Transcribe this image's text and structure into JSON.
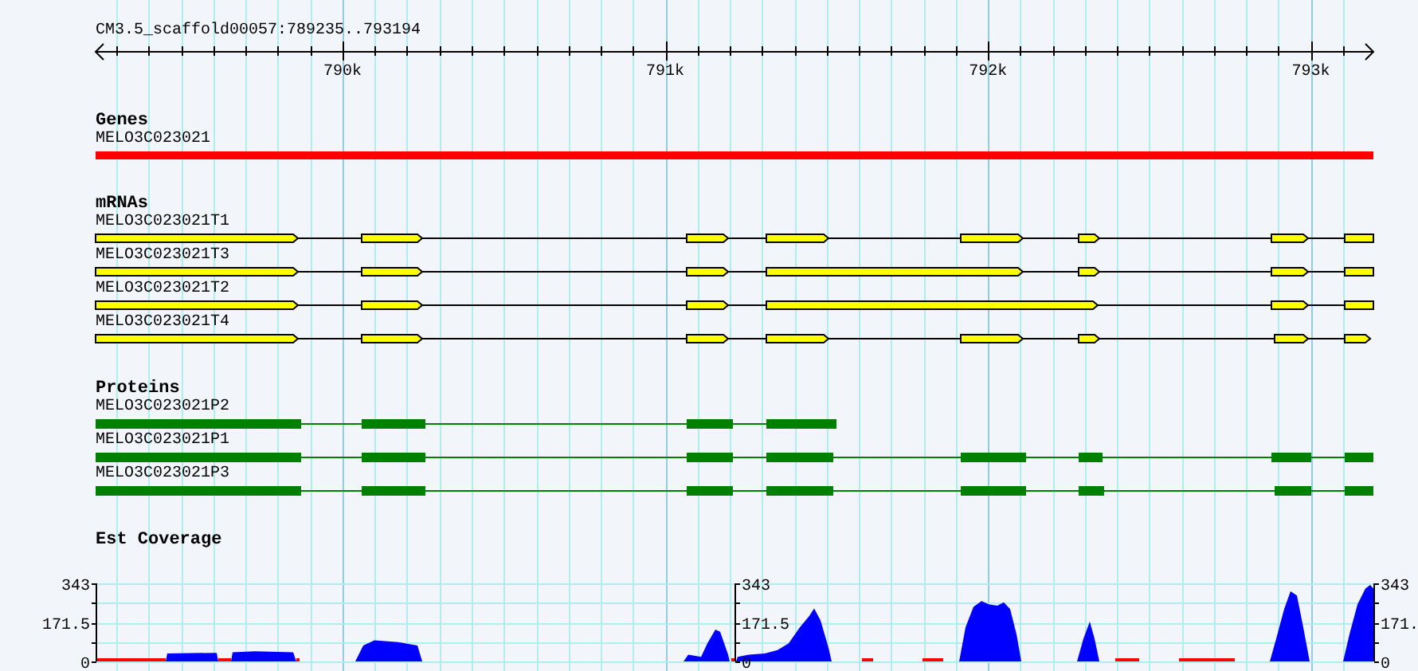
{
  "ruler": {
    "label": "CM3.5_scaffold00057:789235..793194",
    "ticks": [
      {
        "label": "790k"
      },
      {
        "label": "791k"
      },
      {
        "label": "792k"
      },
      {
        "label": "793k"
      }
    ]
  },
  "tracks": [
    {
      "kind": "gene",
      "title": "Genes",
      "features": [
        {
          "name": "MELO3C023021"
        }
      ]
    },
    {
      "kind": "mrna",
      "title": "mRNAs",
      "features": [
        {
          "name": "MELO3C023021T1"
        },
        {
          "name": "MELO3C023021T3"
        },
        {
          "name": "MELO3C023021T2"
        },
        {
          "name": "MELO3C023021T4"
        }
      ]
    },
    {
      "kind": "protein",
      "title": "Proteins",
      "features": [
        {
          "name": "MELO3C023021P2"
        },
        {
          "name": "MELO3C023021P1"
        },
        {
          "name": "MELO3C023021P3"
        }
      ]
    },
    {
      "kind": "coverage",
      "title": "Est Coverage",
      "y_axes": [
        [
          "343",
          "171.5",
          "0"
        ],
        [
          "343",
          "171.5",
          "0"
        ],
        [
          "343",
          "171.",
          "0"
        ]
      ]
    }
  ]
}
